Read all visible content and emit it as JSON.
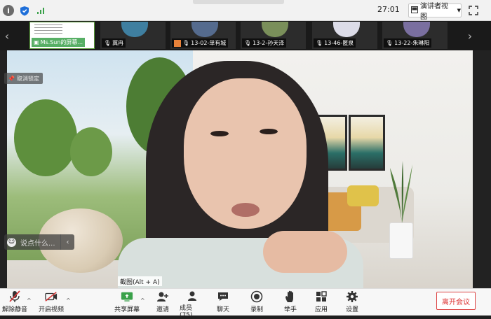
{
  "topbar": {
    "timer": "27:01",
    "speaker_view_label": "演讲者视图"
  },
  "filmstrip": {
    "participants": [
      {
        "name": "Ms.Sun的屏幕...",
        "kind": "screen"
      },
      {
        "name": "冀冉",
        "kind": "avatar",
        "avatar_color": "#3f7fa0"
      },
      {
        "name": "13-02-单有城",
        "kind": "avatar",
        "avatar_color": "#556b8e"
      },
      {
        "name": "13-2-孙天泽",
        "kind": "avatar",
        "avatar_color": "#7a8f5a"
      },
      {
        "name": "13-46-匿泉",
        "kind": "avatar",
        "avatar_color": "#dcdce8"
      },
      {
        "name": "13-22-朱琳阳",
        "kind": "avatar",
        "avatar_color": "#7a6fa0"
      }
    ]
  },
  "overlay": {
    "cancel_pin_label": "取消锁定",
    "chat_placeholder": "说点什么...",
    "screenshot_tip": "截图(Alt + A)"
  },
  "toolbar": {
    "unmute_label": "解除静音",
    "start_video_label": "开启视频",
    "share_screen_label": "共享屏幕",
    "invite_label": "邀请",
    "participants_label": "成员(75)",
    "chat_label": "聊天",
    "record_label": "录制",
    "raise_hand_label": "举手",
    "apps_label": "应用",
    "settings_label": "设置",
    "leave_label": "离开会议"
  },
  "colors": {
    "accent_green": "#3aa14a",
    "mute_red": "#d43a3a",
    "leave_red": "#d33333"
  }
}
